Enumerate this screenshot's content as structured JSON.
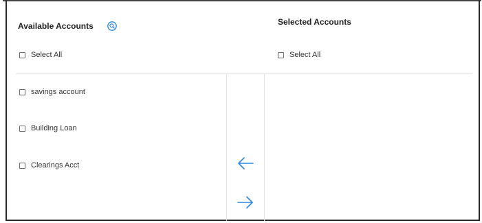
{
  "available": {
    "title": "Available Accounts",
    "select_all_label": "Select All",
    "items": [
      {
        "label": "savings account"
      },
      {
        "label": "Building Loan"
      },
      {
        "label": "Clearings Acct"
      }
    ]
  },
  "selected": {
    "title": "Selected Accounts",
    "select_all_label": "Select All",
    "items": []
  },
  "icons": {
    "search": "search-icon",
    "move_left": "arrow-left-icon",
    "move_right": "arrow-right-icon"
  },
  "colors": {
    "accent": "#2b87e3",
    "border": "#2b2b2b",
    "divider": "#e3e3e3"
  }
}
